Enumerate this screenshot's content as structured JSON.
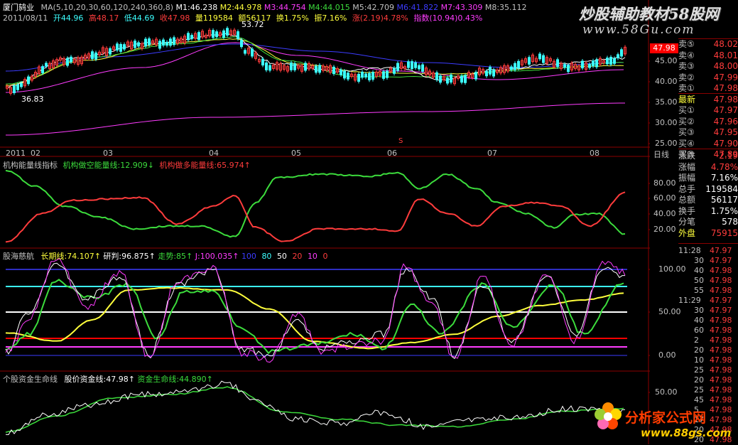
{
  "watermark": {
    "top_text": "炒股辅助教材58股网",
    "top_url": "www.58Gu.com",
    "bottom_text": "分析家公式网",
    "bottom_url": "www.88gs.com"
  },
  "header": {
    "stock_name": "厦门鸫业",
    "ma_label": "MA(5,10,20,30,60,120,240,360,8)",
    "m1": "M1:46.238",
    "m2": "M2:44.978",
    "m3": "M3:44.754",
    "m4": "M4:44.015",
    "m5": "M5:42.709",
    "m6": "M6:41.822",
    "m7": "M7:43.309",
    "m8": "M8:35.112",
    "date": "2011/08/11",
    "open": "开44.96",
    "high": "高48.17",
    "low": "低44.69",
    "close": "收47.98",
    "volume": "量119584",
    "amount": "额56117",
    "turnover": "换1.75%",
    "amplitude": "振7.16%",
    "change": "涨(2.19)4.78%",
    "index": "指数(10.94)0.43%"
  },
  "price_panel": {
    "y_ticks": [
      "45.00",
      "40.00",
      "35.00",
      "30.00",
      "25.00"
    ],
    "current_price_tag": "47.98",
    "high_marker": "53.72",
    "low_marker": "36.83",
    "x_labels": [
      "2011",
      "02",
      "03",
      "04",
      "05",
      "06",
      "07",
      "08"
    ],
    "period_button": "日线"
  },
  "panel2": {
    "title": "机构能量线指标",
    "green_line": "机构做空能量线:12.909",
    "red_line": "机构做多能量线:65.974",
    "y_ticks": [
      "80.00",
      "60.00",
      "40.00",
      "20.00"
    ]
  },
  "panel3": {
    "title": "股海慈航",
    "long_line": "长期线:74.107",
    "judge": "研判:96.875",
    "trend": "走势:85",
    "j_val": "J:100.035",
    "levels": [
      "80",
      "50",
      "20",
      "10",
      "0"
    ],
    "y_ticks": [
      "100.00",
      "50.00",
      "0.00"
    ]
  },
  "panel4": {
    "title": "个股资金生命线",
    "price_fund": "股价资金线:47.98",
    "fund_life": "资金生命线:44.890",
    "y_ticks": [
      "50.00",
      "0.00"
    ]
  },
  "order_book": [
    {
      "label": "卖⑤",
      "value": "48.02"
    },
    {
      "label": "卖④",
      "value": "48.01"
    },
    {
      "label": "卖③",
      "value": "48.00"
    },
    {
      "label": "卖②",
      "value": "47.99"
    },
    {
      "label": "卖①",
      "value": "47.98"
    },
    {
      "label": "最新",
      "value": "47.98"
    },
    {
      "label": "买①",
      "value": "47.97"
    },
    {
      "label": "买②",
      "value": "47.96"
    },
    {
      "label": "买③",
      "value": "47.95"
    },
    {
      "label": "买④",
      "value": "47.90"
    },
    {
      "label": "买⑤",
      "value": "47.89"
    }
  ],
  "stats": [
    {
      "label": "涨跌",
      "value": "2.19"
    },
    {
      "label": "涨幅",
      "value": "4.78%"
    },
    {
      "label": "振幅",
      "value": "7.16%"
    },
    {
      "label": "总手",
      "value": "119584"
    },
    {
      "label": "总额",
      "value": "56117"
    },
    {
      "label": "换手",
      "value": "1.75%"
    },
    {
      "label": "分笔",
      "value": "578"
    },
    {
      "label": "外盘",
      "value": "75915"
    }
  ],
  "ticks": [
    {
      "time": "11:28",
      "price": "47.97"
    },
    {
      "time": "30",
      "price": "47.97"
    },
    {
      "time": "40",
      "price": "47.98"
    },
    {
      "time": "50",
      "price": "47.98"
    },
    {
      "time": "55",
      "price": "47.98"
    },
    {
      "time": "11:29",
      "price": "47.97"
    },
    {
      "time": "30",
      "price": "47.97"
    },
    {
      "time": "40",
      "price": "47.98"
    },
    {
      "time": "60",
      "price": "47.98"
    },
    {
      "time": "2",
      "price": "47.98"
    },
    {
      "time": "20",
      "price": "47.98"
    },
    {
      "time": "10",
      "price": "47.98"
    },
    {
      "time": "25",
      "price": "47.98"
    },
    {
      "time": "20",
      "price": "47.98"
    },
    {
      "time": "25",
      "price": "47.98"
    },
    {
      "time": "45",
      "price": "47.98"
    },
    {
      "time": "5",
      "price": "47.98"
    },
    {
      "time": "17",
      "price": "47.98"
    },
    {
      "time": "20",
      "price": "47.98"
    },
    {
      "time": "20",
      "price": "47.98"
    }
  ],
  "colors": {
    "red": "#ff3c3c",
    "green": "#3cdc3c",
    "yellow": "#ffff3c",
    "white": "#ffffff",
    "magenta": "#ff3cff",
    "cyan": "#3cffff",
    "blue": "#3c3cff",
    "grid": "#8b0000"
  }
}
